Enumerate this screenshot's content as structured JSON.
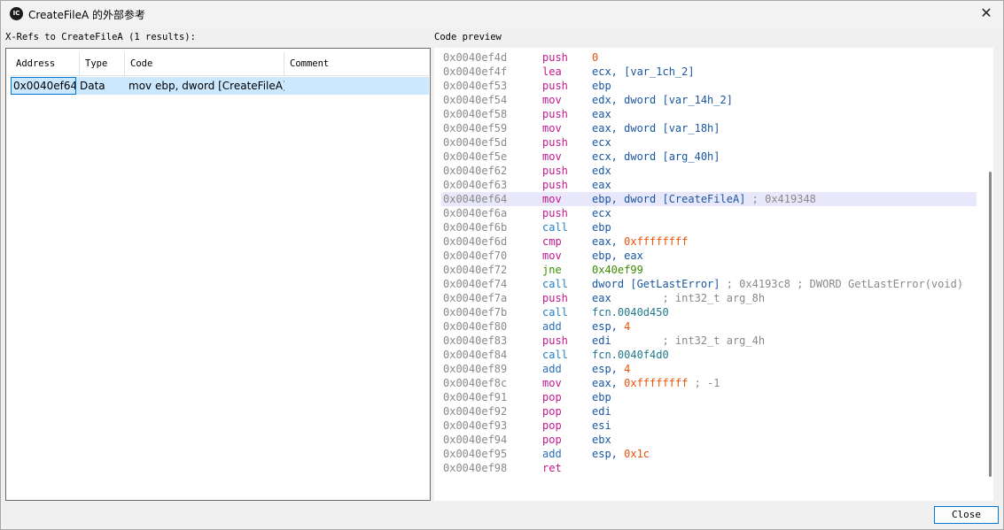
{
  "window": {
    "title": "CreateFileA 的外部参考",
    "icon_text": "IC"
  },
  "xrefs": {
    "label": "X-Refs to CreateFileA (1 results):",
    "columns": [
      "Address",
      "Type",
      "Code",
      "Comment"
    ],
    "rows": [
      {
        "address": "0x0040ef64",
        "type": "Data",
        "code": "mov ebp, dword [CreateFileA]",
        "comment": ""
      }
    ]
  },
  "preview": {
    "label": "Code preview",
    "highlight_index": 10,
    "lines": [
      {
        "addr": "0x0040ef4d",
        "mn": "push",
        "ops": [
          [
            "0",
            "num"
          ]
        ]
      },
      {
        "addr": "0x0040ef4f",
        "mn": "lea",
        "ops": [
          [
            "ecx, [",
            "reg"
          ],
          [
            "var_1ch_2",
            "var"
          ],
          [
            "]",
            "reg"
          ]
        ]
      },
      {
        "addr": "0x0040ef53",
        "mn": "push",
        "ops": [
          [
            "ebp",
            "reg"
          ]
        ]
      },
      {
        "addr": "0x0040ef54",
        "mn": "mov",
        "ops": [
          [
            "edx, dword [",
            "reg"
          ],
          [
            "var_14h_2",
            "var"
          ],
          [
            "]",
            "reg"
          ]
        ]
      },
      {
        "addr": "0x0040ef58",
        "mn": "push",
        "ops": [
          [
            "eax",
            "reg"
          ]
        ]
      },
      {
        "addr": "0x0040ef59",
        "mn": "mov",
        "ops": [
          [
            "eax, dword [",
            "reg"
          ],
          [
            "var_18h",
            "var"
          ],
          [
            "]",
            "reg"
          ]
        ]
      },
      {
        "addr": "0x0040ef5d",
        "mn": "push",
        "ops": [
          [
            "ecx",
            "reg"
          ]
        ]
      },
      {
        "addr": "0x0040ef5e",
        "mn": "mov",
        "ops": [
          [
            "ecx, dword [",
            "reg"
          ],
          [
            "arg_40h",
            "var"
          ],
          [
            "]",
            "reg"
          ]
        ]
      },
      {
        "addr": "0x0040ef62",
        "mn": "push",
        "ops": [
          [
            "edx",
            "reg"
          ]
        ]
      },
      {
        "addr": "0x0040ef63",
        "mn": "push",
        "ops": [
          [
            "eax",
            "reg"
          ]
        ]
      },
      {
        "addr": "0x0040ef64",
        "mn": "mov",
        "ops": [
          [
            "ebp, dword [",
            "reg"
          ],
          [
            "CreateFileA",
            "var"
          ],
          [
            "] ",
            "reg"
          ],
          [
            "; 0x419348",
            "cmt"
          ]
        ]
      },
      {
        "addr": "0x0040ef6a",
        "mn": "push",
        "ops": [
          [
            "ecx",
            "reg"
          ]
        ]
      },
      {
        "addr": "0x0040ef6b",
        "mn": "call",
        "ops": [
          [
            "ebp",
            "reg"
          ]
        ]
      },
      {
        "addr": "0x0040ef6d",
        "mn": "cmp",
        "ops": [
          [
            "eax, ",
            "reg"
          ],
          [
            "0xffffffff",
            "num"
          ]
        ]
      },
      {
        "addr": "0x0040ef70",
        "mn": "mov",
        "ops": [
          [
            "ebp, eax",
            "reg"
          ]
        ]
      },
      {
        "addr": "0x0040ef72",
        "mn": "jne",
        "ops": [
          [
            "0x40ef99",
            "jmp"
          ]
        ]
      },
      {
        "addr": "0x0040ef74",
        "mn": "call",
        "ops": [
          [
            "dword [",
            "reg"
          ],
          [
            "GetLastError",
            "var"
          ],
          [
            "] ",
            "reg"
          ],
          [
            "; 0x4193c8 ; DWORD GetLastError(void)",
            "cmt"
          ]
        ]
      },
      {
        "addr": "0x0040ef7a",
        "mn": "push",
        "ops": [
          [
            "eax",
            "reg"
          ],
          [
            "        ; int32_t arg_8h",
            "cmt"
          ]
        ]
      },
      {
        "addr": "0x0040ef7b",
        "mn": "call",
        "ops": [
          [
            "fcn.0040d450",
            "fcn"
          ]
        ]
      },
      {
        "addr": "0x0040ef80",
        "mn": "add",
        "ops": [
          [
            "esp, ",
            "reg"
          ],
          [
            "4",
            "num"
          ]
        ]
      },
      {
        "addr": "0x0040ef83",
        "mn": "push",
        "ops": [
          [
            "edi",
            "reg"
          ],
          [
            "        ; int32_t arg_4h",
            "cmt"
          ]
        ]
      },
      {
        "addr": "0x0040ef84",
        "mn": "call",
        "ops": [
          [
            "fcn.0040f4d0",
            "fcn"
          ]
        ]
      },
      {
        "addr": "0x0040ef89",
        "mn": "add",
        "ops": [
          [
            "esp, ",
            "reg"
          ],
          [
            "4",
            "num"
          ]
        ]
      },
      {
        "addr": "0x0040ef8c",
        "mn": "mov",
        "ops": [
          [
            "eax, ",
            "reg"
          ],
          [
            "0xffffffff",
            "num"
          ],
          [
            " ; -1",
            "cmt"
          ]
        ]
      },
      {
        "addr": "0x0040ef91",
        "mn": "pop",
        "ops": [
          [
            "ebp",
            "reg"
          ]
        ]
      },
      {
        "addr": "0x0040ef92",
        "mn": "pop",
        "ops": [
          [
            "edi",
            "reg"
          ]
        ]
      },
      {
        "addr": "0x0040ef93",
        "mn": "pop",
        "ops": [
          [
            "esi",
            "reg"
          ]
        ]
      },
      {
        "addr": "0x0040ef94",
        "mn": "pop",
        "ops": [
          [
            "ebx",
            "reg"
          ]
        ]
      },
      {
        "addr": "0x0040ef95",
        "mn": "add",
        "ops": [
          [
            "esp, ",
            "reg"
          ],
          [
            "0x1c",
            "num"
          ]
        ]
      },
      {
        "addr": "0x0040ef98",
        "mn": "ret",
        "ops": []
      }
    ]
  },
  "buttons": {
    "close": "Close"
  },
  "colors": {
    "mn_push": "#c0188c",
    "mn_mov": "#c0188c",
    "mn_lea": "#c0188c",
    "mn_pop": "#c0188c",
    "mn_cmp": "#c0188c",
    "mn_call": "#2580c0",
    "mn_add": "#2a6eb8",
    "mn_ret": "#c0188c",
    "mn_jne": "#3c8c00",
    "reg": "#1a56a0",
    "var": "#1a56a0",
    "num": "#e8540a",
    "cmt": "#8a8a8a",
    "jmp": "#3c8c00",
    "fcn": "#1f7a8c"
  }
}
